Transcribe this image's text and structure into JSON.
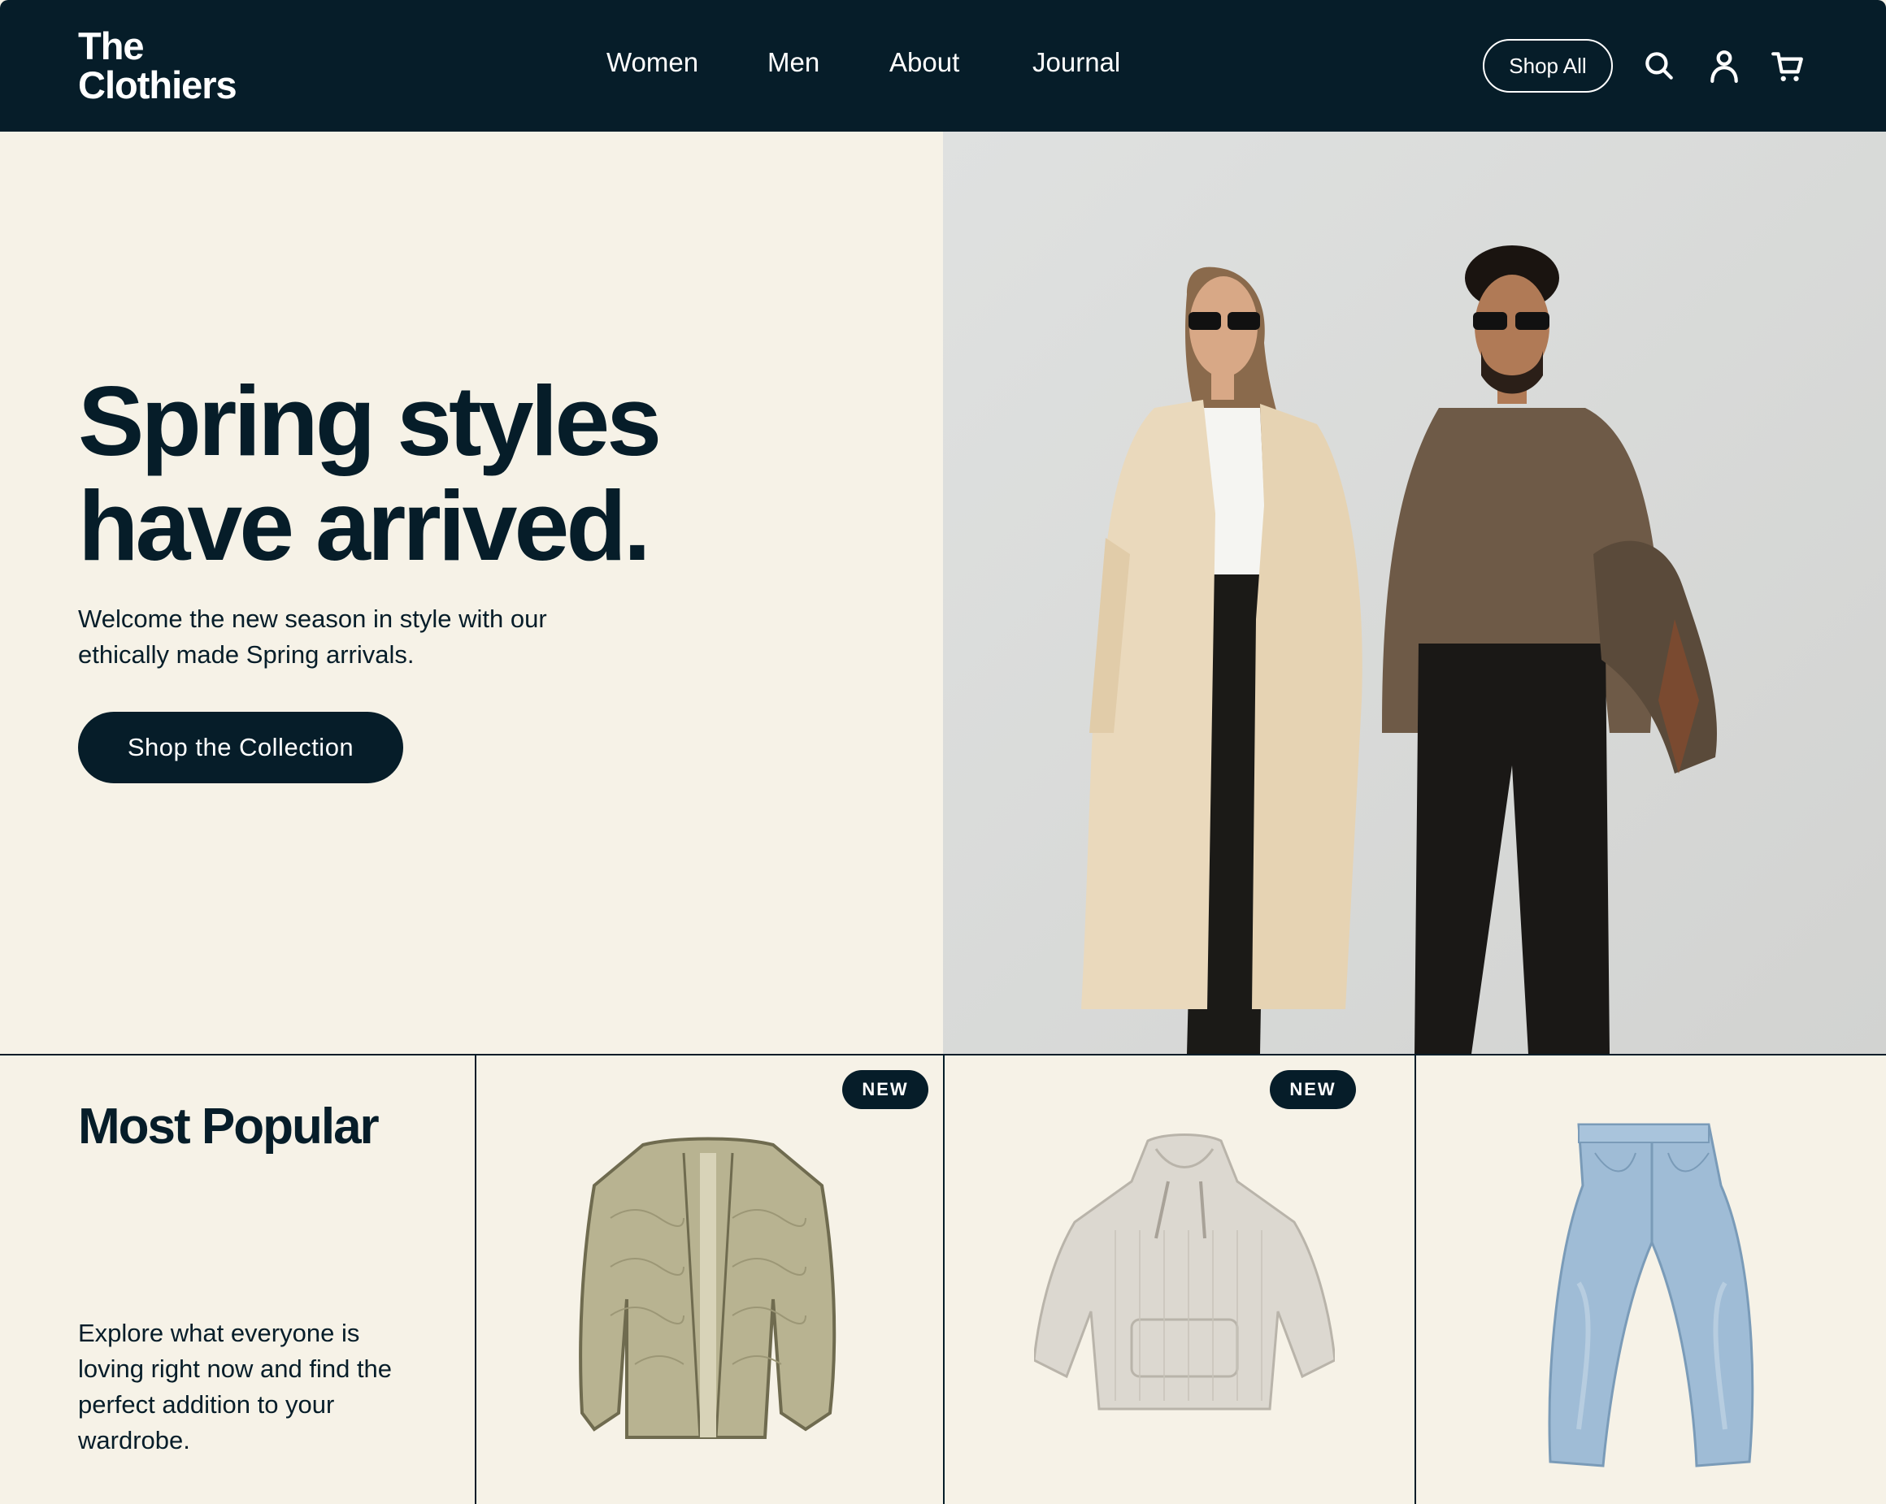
{
  "header": {
    "logo_line1": "The",
    "logo_line2": "Clothiers",
    "nav": [
      "Women",
      "Men",
      "About",
      "Journal"
    ],
    "shop_all": "Shop All",
    "icons": [
      "search-icon",
      "account-icon",
      "cart-icon"
    ]
  },
  "hero": {
    "title_line1": "Spring styles",
    "title_line2": "have arrived.",
    "subtitle_line1": "Welcome the new season in style with our",
    "subtitle_line2": "ethically made Spring arrivals.",
    "cta": "Shop the Collection",
    "image": "two models wearing spring outfits"
  },
  "popular": {
    "title": "Most Popular",
    "description": "Explore what everyone is loving right now and find the perfect addition to your wardrobe.",
    "products": [
      {
        "name": "quilted-jacket",
        "badge": "NEW"
      },
      {
        "name": "knit-hoodie",
        "badge": "NEW"
      },
      {
        "name": "light-wash-jeans",
        "badge": ""
      }
    ]
  },
  "colors": {
    "primary": "#061d29",
    "background": "#f6f2e7",
    "white": "#ffffff"
  }
}
